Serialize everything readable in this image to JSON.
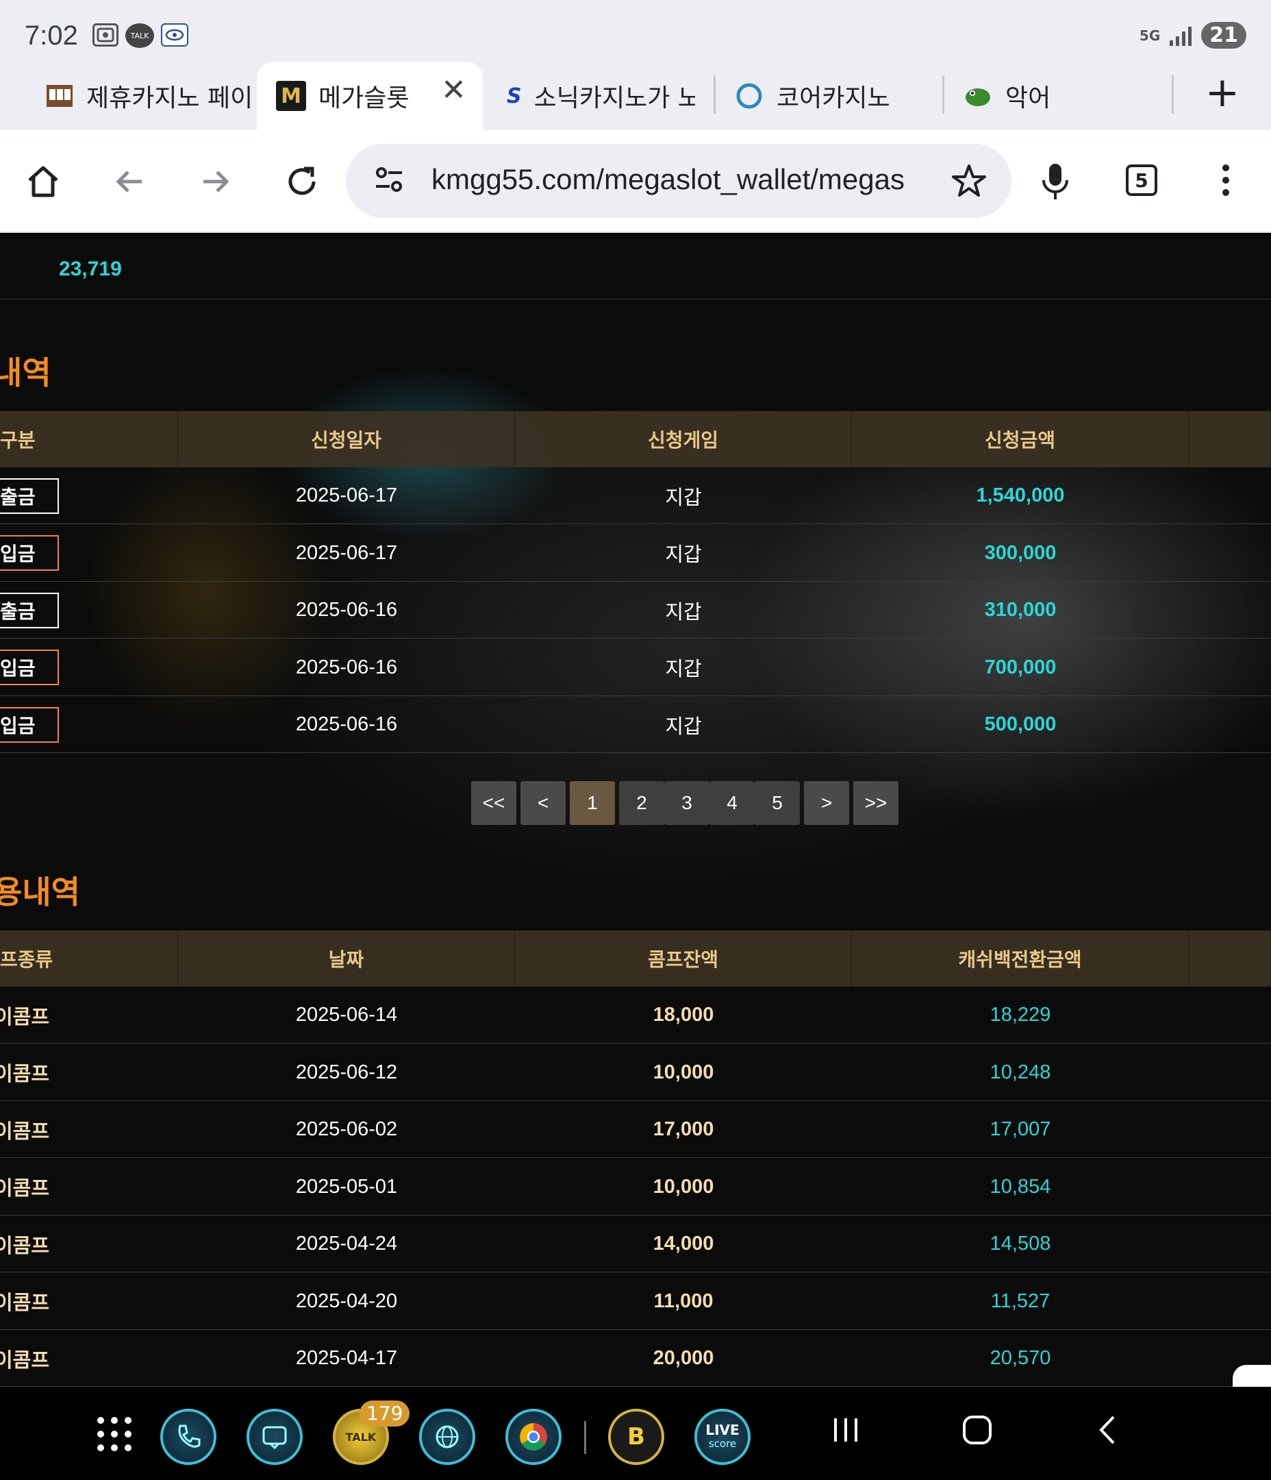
{
  "status_bar": {
    "time": "7:02",
    "talk_label": "TALK",
    "net": "5G",
    "battery": "21"
  },
  "tabs": [
    {
      "title": "제휴카지노 페이",
      "icon": "slot-machine-icon"
    },
    {
      "title": "메가슬롯",
      "icon": "m-logo-icon"
    },
    {
      "title": "소닉카지노가 노",
      "icon": "sonic-s-icon"
    },
    {
      "title": "코어카지노",
      "icon": "ring-icon"
    },
    {
      "title": "악어",
      "icon": "crocodile-icon"
    }
  ],
  "toolbar": {
    "url": "kmgg55.com/megaslot_wallet/megas",
    "tab_count": "5"
  },
  "page": {
    "points_value": "23,719",
    "section1_title": "내역",
    "section1_headers": [
      "구분",
      "신청일자",
      "신청게임",
      "신청금액"
    ],
    "section1_rows": [
      {
        "type": "출금",
        "kind": "withdraw",
        "date": "2025-06-17",
        "game": "지갑",
        "amount": "1,540,000"
      },
      {
        "type": "입금",
        "kind": "deposit",
        "date": "2025-06-17",
        "game": "지갑",
        "amount": "300,000"
      },
      {
        "type": "출금",
        "kind": "withdraw",
        "date": "2025-06-16",
        "game": "지갑",
        "amount": "310,000"
      },
      {
        "type": "입금",
        "kind": "deposit",
        "date": "2025-06-16",
        "game": "지갑",
        "amount": "700,000"
      },
      {
        "type": "입금",
        "kind": "deposit",
        "date": "2025-06-16",
        "game": "지갑",
        "amount": "500,000"
      }
    ],
    "pager": {
      "first": "<<",
      "prev": "<",
      "pages": [
        "1",
        "2",
        "3",
        "4",
        "5"
      ],
      "current": "1",
      "next": ">",
      "last": ">>"
    },
    "section2_title": "용내역",
    "section2_headers": [
      "프종류",
      "날짜",
      "콤프잔액",
      "캐쉬백전환금액"
    ],
    "section2_rows": [
      {
        "type": "이콤프",
        "date": "2025-06-14",
        "balance": "18,000",
        "cashback": "18,229"
      },
      {
        "type": "이콤프",
        "date": "2025-06-12",
        "balance": "10,000",
        "cashback": "10,248"
      },
      {
        "type": "이콤프",
        "date": "2025-06-02",
        "balance": "17,000",
        "cashback": "17,007"
      },
      {
        "type": "이콤프",
        "date": "2025-05-01",
        "balance": "10,000",
        "cashback": "10,854"
      },
      {
        "type": "이콤프",
        "date": "2025-04-24",
        "balance": "14,000",
        "cashback": "14,508"
      },
      {
        "type": "이콤프",
        "date": "2025-04-20",
        "balance": "11,000",
        "cashback": "11,527"
      },
      {
        "type": "이콤프",
        "date": "2025-04-17",
        "balance": "20,000",
        "cashback": "20,570"
      }
    ]
  },
  "dock": {
    "kakao_badge": "179",
    "kakao_label": "TALK",
    "live_label": "LIVE",
    "live_sub": "score",
    "b_label": "B"
  },
  "colors": {
    "accent_orange": "#f28c1f",
    "amount_cyan": "#2ad7d7",
    "header_gold": "#e8c98a"
  }
}
